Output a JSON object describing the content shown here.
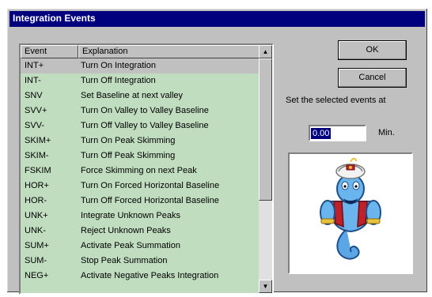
{
  "window": {
    "title": "Integration Events"
  },
  "list": {
    "columns": [
      "Event",
      "Explanation"
    ],
    "rows": [
      {
        "event": "INT+",
        "explanation": "Turn On Integration"
      },
      {
        "event": "INT-",
        "explanation": "Turn Off Integration"
      },
      {
        "event": "SNV",
        "explanation": "Set Baseline at next valley"
      },
      {
        "event": "SVV+",
        "explanation": "Turn On Valley to Valley Baseline"
      },
      {
        "event": "SVV-",
        "explanation": "Turn Off Valley to Valley Baseline"
      },
      {
        "event": "SKIM+",
        "explanation": "Turn On Peak Skimming"
      },
      {
        "event": "SKIM-",
        "explanation": "Turn Off Peak Skimming"
      },
      {
        "event": "FSKIM",
        "explanation": "Force Skimming on next Peak"
      },
      {
        "event": "HOR+",
        "explanation": "Turn On Forced Horizontal Baseline"
      },
      {
        "event": "HOR-",
        "explanation": "Turn Off Forced Horizontal Baseline"
      },
      {
        "event": "UNK+",
        "explanation": "Integrate Unknown Peaks"
      },
      {
        "event": "UNK-",
        "explanation": "Reject Unknown Peaks"
      },
      {
        "event": "SUM+",
        "explanation": "Activate Peak Summation"
      },
      {
        "event": "SUM-",
        "explanation": "Stop Peak Summation"
      },
      {
        "event": "NEG+",
        "explanation": "Activate Negative Peaks Integration"
      }
    ],
    "selected_index": 0
  },
  "buttons": {
    "ok": "OK",
    "cancel": "Cancel"
  },
  "time_prompt": "Set the selected events at",
  "time_value": "0.00",
  "time_unit": "Min.",
  "colors": {
    "title_bg": "#00007f",
    "list_bg": "#c0ddc0",
    "face": "#c0c0c0"
  },
  "icons": {
    "scroll_up": "up-arrow-icon",
    "scroll_down": "down-arrow-icon",
    "illustration": "genie-illustration"
  }
}
